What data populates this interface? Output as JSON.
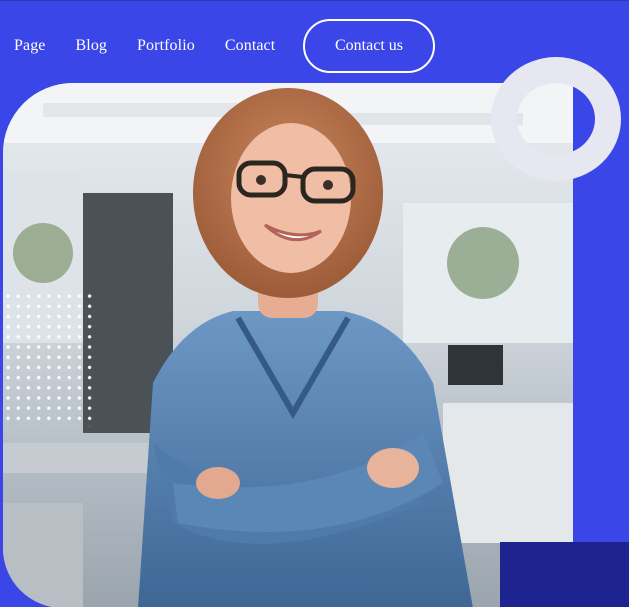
{
  "nav": {
    "items": [
      {
        "label": "Page"
      },
      {
        "label": "Blog"
      },
      {
        "label": "Portfolio"
      },
      {
        "label": "Contact"
      }
    ],
    "cta_label": "Contact us"
  },
  "colors": {
    "brand_blue": "#3a46e8",
    "dark_blue": "#1d2490",
    "ring": "#e6e7f1"
  },
  "hero": {
    "image_subject": "smiling woman with glasses in denim jacket, arms crossed, in office"
  }
}
